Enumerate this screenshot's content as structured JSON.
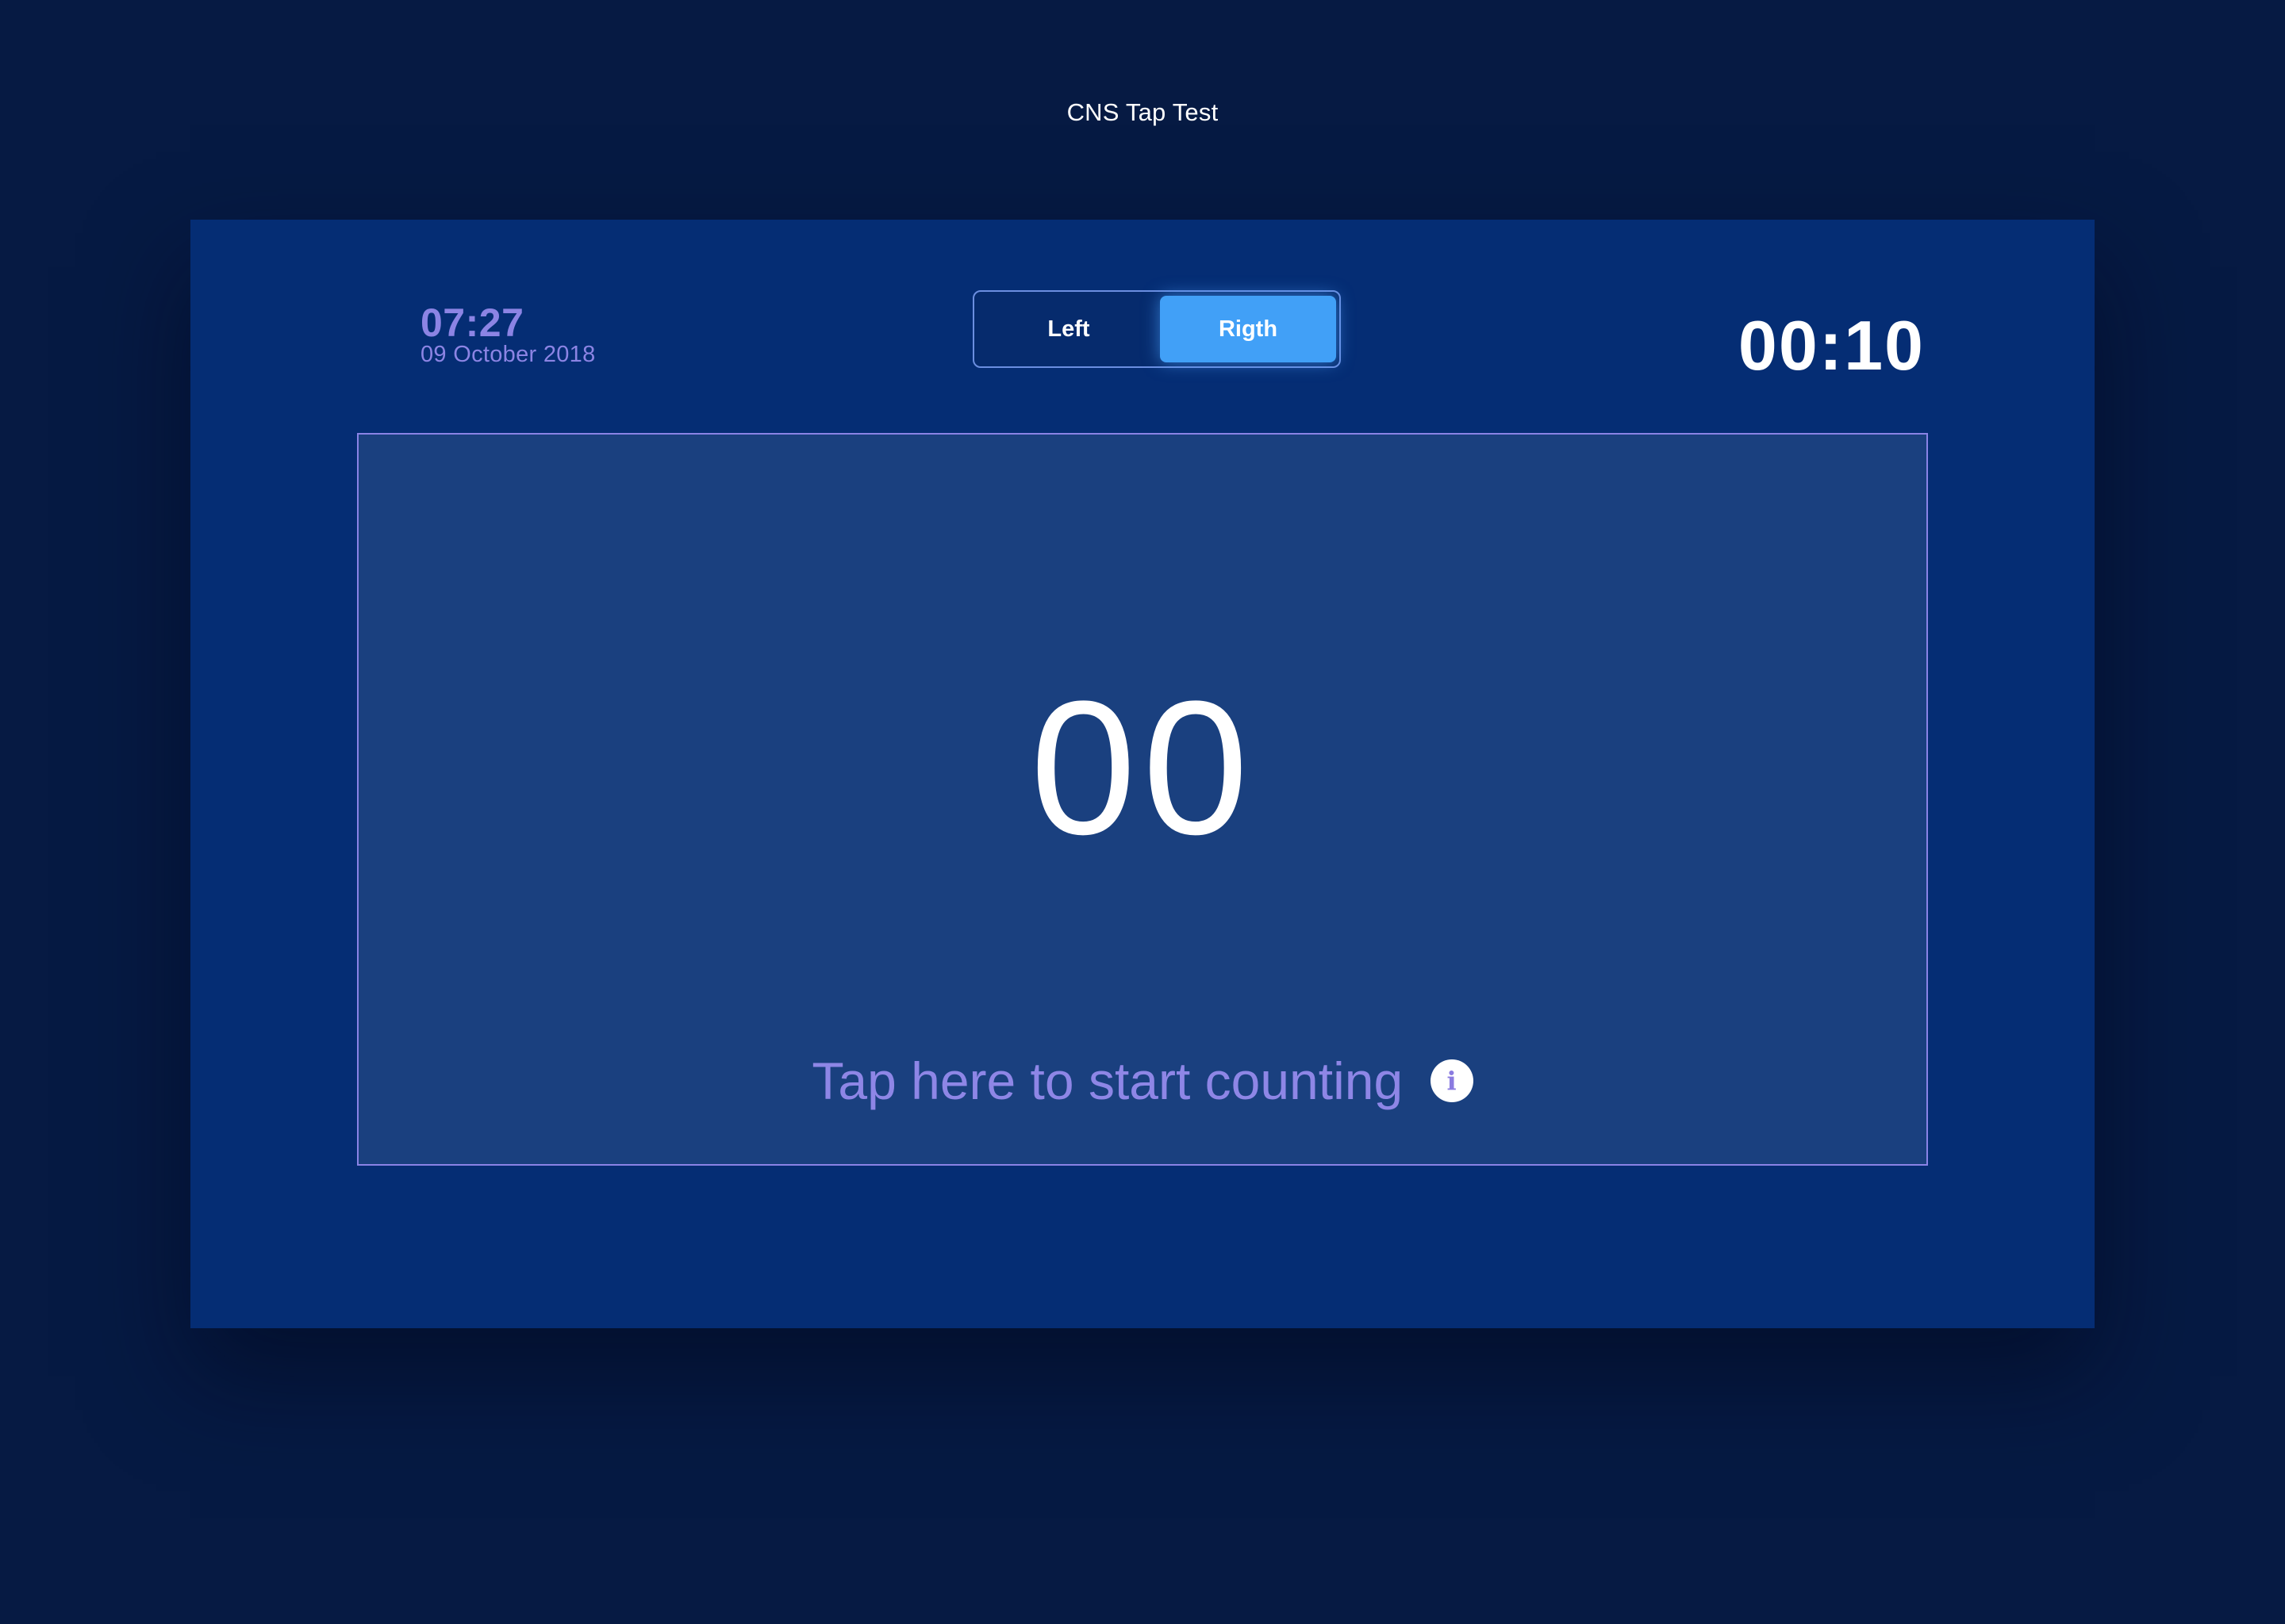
{
  "app": {
    "title": "CNS Tap Test"
  },
  "clock": {
    "time": "07:27",
    "date": "09 October 2018"
  },
  "hand_toggle": {
    "options": [
      {
        "label": "Left",
        "active": false
      },
      {
        "label": "Rigth",
        "active": true
      }
    ]
  },
  "timer": {
    "value": "00:10"
  },
  "tap_area": {
    "count": "00",
    "prompt": "Tap here to start counting",
    "info_icon": "info-icon",
    "info_glyph": "i"
  },
  "colors": {
    "background": "#061a43",
    "panel": "#052d74",
    "tap_area": "#1a407f",
    "accent": "#41a0f7",
    "label_purple": "#8c84e4",
    "text": "#ffffff"
  }
}
